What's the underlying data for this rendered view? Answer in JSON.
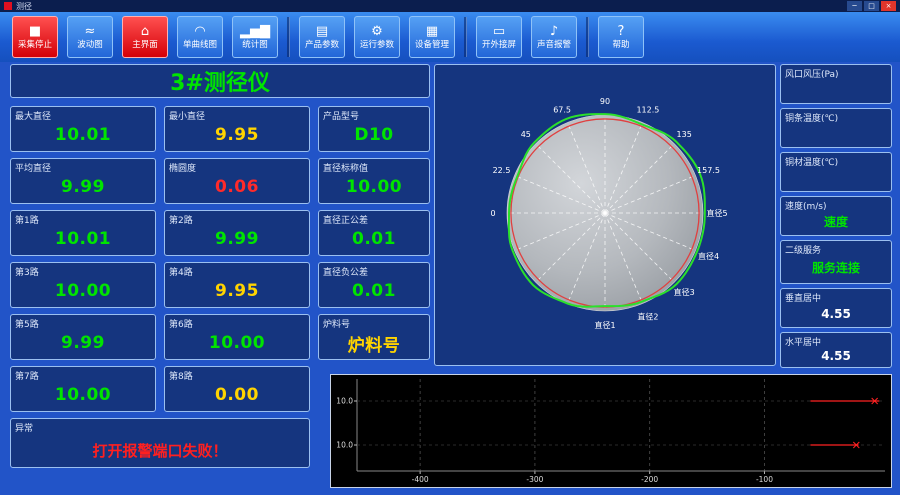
{
  "window": {
    "title": "测径",
    "controls": [
      {
        "name": "minimize-button",
        "glyph": "─"
      },
      {
        "name": "maximize-button",
        "glyph": "□"
      },
      {
        "name": "close-button",
        "glyph": "×",
        "close": true
      }
    ]
  },
  "toolbar": {
    "buttons": [
      {
        "label": "采集停止",
        "icon": "stop-collect-icon",
        "glyph": "■",
        "active": true,
        "group_end": false
      },
      {
        "label": "波动图",
        "icon": "wave-chart-icon",
        "glyph": "≈",
        "active": false,
        "group_end": false
      },
      {
        "label": "主界面",
        "icon": "home-icon",
        "glyph": "⌂",
        "active": true,
        "group_end": false
      },
      {
        "label": "单曲线图",
        "icon": "curve-chart-icon",
        "glyph": "◠",
        "active": false,
        "group_end": false
      },
      {
        "label": "统计图",
        "icon": "bar-chart-icon",
        "glyph": "▂▅▇",
        "active": false,
        "group_end": true
      },
      {
        "label": "产品参数",
        "icon": "product-params-icon",
        "glyph": "▤",
        "active": false,
        "group_end": false
      },
      {
        "label": "运行参数",
        "icon": "run-params-icon",
        "glyph": "⚙",
        "active": false,
        "group_end": false
      },
      {
        "label": "设备管理",
        "icon": "device-manage-icon",
        "glyph": "▦",
        "active": false,
        "group_end": true
      },
      {
        "label": "开外接屏",
        "icon": "external-screen-icon",
        "glyph": "▭",
        "active": false,
        "group_end": false
      },
      {
        "label": "声音报警",
        "icon": "sound-alarm-icon",
        "glyph": "♪",
        "active": false,
        "group_end": true
      },
      {
        "label": "帮助",
        "icon": "help-icon",
        "glyph": "?",
        "active": false,
        "group_end": false
      }
    ]
  },
  "left_panel": {
    "title": "3#测径仪",
    "metrics": [
      {
        "label": "最大直径",
        "value": "10.01",
        "color": "green"
      },
      {
        "label": "最小直径",
        "value": "9.95",
        "color": "yellow"
      },
      {
        "label": "产品型号",
        "value": "D10",
        "color": "green"
      },
      {
        "label": "平均直径",
        "value": "9.99",
        "color": "green"
      },
      {
        "label": "椭圆度",
        "value": "0.06",
        "color": "red"
      },
      {
        "label": "直径标称值",
        "value": "10.00",
        "color": "green"
      },
      {
        "label": "第1路",
        "value": "10.01",
        "color": "green"
      },
      {
        "label": "第2路",
        "value": "9.99",
        "color": "green"
      },
      {
        "label": "直径正公差",
        "value": "0.01",
        "color": "green"
      },
      {
        "label": "第3路",
        "value": "10.00",
        "color": "green"
      },
      {
        "label": "第4路",
        "value": "9.95",
        "color": "yellow"
      },
      {
        "label": "直径负公差",
        "value": "0.01",
        "color": "green"
      },
      {
        "label": "第5路",
        "value": "9.99",
        "color": "green"
      },
      {
        "label": "第6路",
        "value": "10.00",
        "color": "green"
      },
      {
        "label": "炉料号",
        "value": "炉料号",
        "color": "yellow"
      },
      {
        "label": "第7路",
        "value": "10.00",
        "color": "green"
      },
      {
        "label": "第8路",
        "value": "0.00",
        "color": "yellow"
      }
    ],
    "alarm": {
      "label": "异常",
      "message": "打开报警端口失败！"
    }
  },
  "right_panel": {
    "items": [
      {
        "label": "风口风压(Pa)",
        "value": "",
        "color": "white"
      },
      {
        "label": "铜条温度(℃)",
        "value": "",
        "color": "white"
      },
      {
        "label": "铜材温度(℃)",
        "value": "",
        "color": "white"
      },
      {
        "label": "速度(m/s)",
        "value": "速度",
        "color": "green"
      },
      {
        "label": "二级服务",
        "value": "服务连接",
        "color": "green"
      },
      {
        "label": "垂直居中",
        "value": "4.55",
        "color": "white"
      },
      {
        "label": "水平居中",
        "value": "4.55",
        "color": "white"
      }
    ]
  },
  "accent_colors": {
    "green": "#00e400",
    "yellow": "#ffd400",
    "red": "#ff2a2a",
    "active_button": "#e01020"
  },
  "chart_data": [
    {
      "id": "cross-section-polar",
      "type": "polar",
      "angle_labels": [
        {
          "deg": 180,
          "text": "0"
        },
        {
          "deg": 157.5,
          "text": "22.5"
        },
        {
          "deg": 135,
          "text": "45"
        },
        {
          "deg": 112.5,
          "text": "67.5"
        },
        {
          "deg": 90,
          "text": "90"
        },
        {
          "deg": 67.5,
          "text": "112.5"
        },
        {
          "deg": 45,
          "text": "135"
        },
        {
          "deg": 22.5,
          "text": "157.5"
        },
        {
          "deg": 0,
          "text": "直径5"
        },
        {
          "deg": -22.5,
          "text": "直径4"
        },
        {
          "deg": -45,
          "text": "直径3"
        },
        {
          "deg": -67.5,
          "text": "直径2"
        },
        {
          "deg": -90,
          "text": "直径1"
        }
      ],
      "profile_radii_rel": [
        1.04,
        1.07,
        1.05,
        1.0,
        1.03,
        1.06,
        1.04,
        0.99,
        1.0,
        1.04,
        1.06,
        1.02,
        0.97,
        1.0,
        1.05,
        1.04
      ],
      "nominal_radius_rel": 0.96,
      "disc_color": "#b4b8bd",
      "profile_color": "#2be02b",
      "nominal_color": "#e04040",
      "spoke_color": "#ffffff"
    },
    {
      "id": "diameter-trend",
      "type": "line",
      "background": "#000000",
      "xlim": [
        -455,
        5
      ],
      "x_ticks": [
        -400,
        -300,
        -200,
        -100
      ],
      "grid": true,
      "subplots": [
        {
          "y_tick": "10.0",
          "trace": {
            "color": "#ff2222",
            "y": 10.0,
            "x_start": -60,
            "x_end": 0,
            "marker_x": -4
          }
        },
        {
          "y_tick": "10.0",
          "trace": {
            "color": "#ff2222",
            "y": 10.0,
            "x_start": -60,
            "x_end": -18,
            "marker_x": -20
          }
        }
      ]
    }
  ]
}
